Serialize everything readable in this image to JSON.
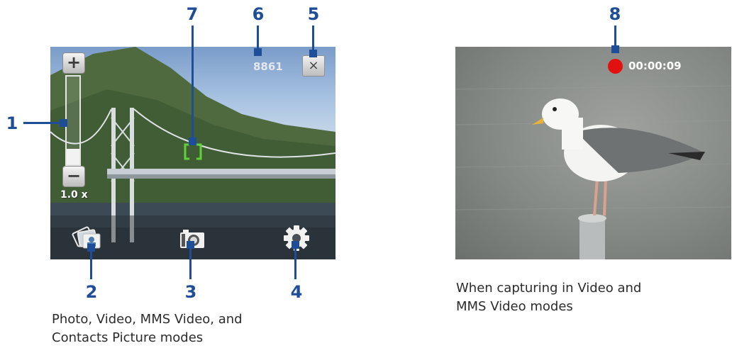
{
  "callouts": {
    "c1": "1",
    "c2": "2",
    "c3": "3",
    "c4": "4",
    "c5": "5",
    "c6": "6",
    "c7": "7",
    "c8": "8"
  },
  "photo_screen": {
    "zoom_in_label": "+",
    "zoom_out_label": "−",
    "zoom_level": "1.0 x",
    "zoom_fraction": 0.0,
    "shots_remaining": "8861",
    "close_label": "×",
    "icons": {
      "zoom_in": "plus-icon",
      "zoom_out": "minus-icon",
      "close": "close-icon",
      "album": "album-icon",
      "capture_mode": "camera-icon",
      "settings": "gear-icon",
      "focus": "focus-bracket-icon"
    }
  },
  "video_screen": {
    "recording_indicator": "record-dot-icon",
    "elapsed_time": "00:00:09"
  },
  "captions": {
    "photo_modes_line1": "Photo, Video, MMS Video, and",
    "photo_modes_line2": "Contacts Picture modes",
    "video_modes_line1": "When capturing in Video and",
    "video_modes_line2": "MMS Video modes"
  },
  "colors": {
    "callout": "#1f4e99",
    "record": "#e31010",
    "focus": "#5fd23a"
  }
}
